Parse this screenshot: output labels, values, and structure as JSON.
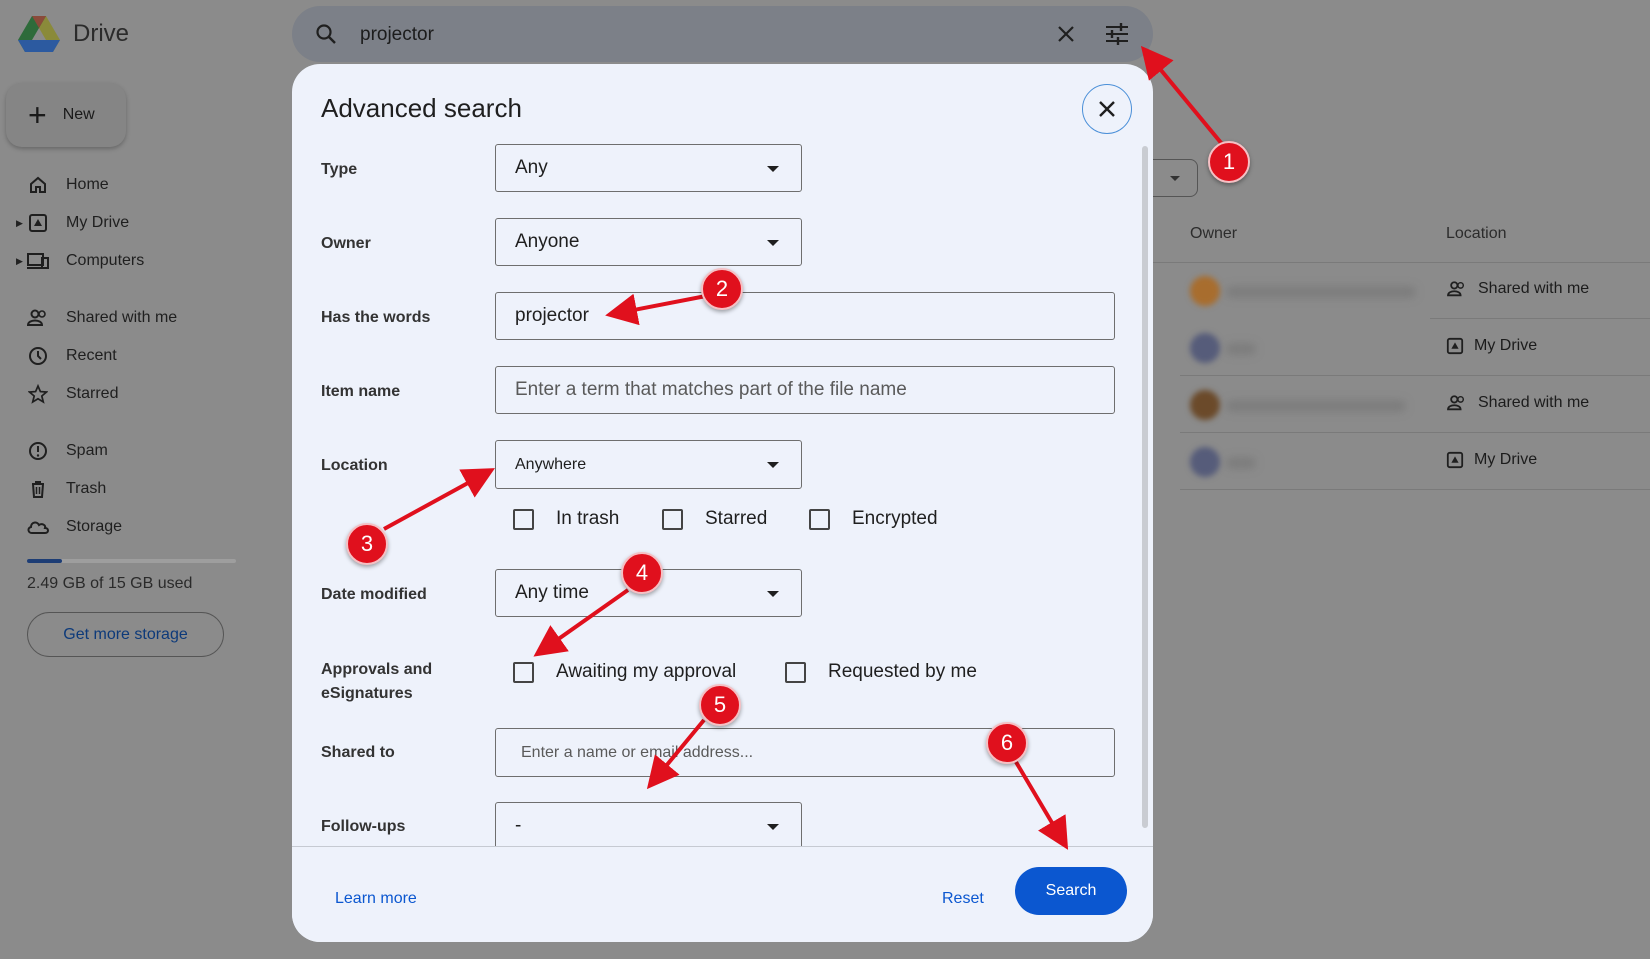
{
  "app": {
    "name": "Drive"
  },
  "sidebar": {
    "new_label": "New",
    "items": [
      {
        "label": "Home",
        "icon": "home-icon"
      },
      {
        "label": "My Drive",
        "icon": "my-drive-icon"
      },
      {
        "label": "Computers",
        "icon": "computers-icon"
      },
      {
        "label": "Shared with me",
        "icon": "people-icon"
      },
      {
        "label": "Recent",
        "icon": "clock-icon"
      },
      {
        "label": "Starred",
        "icon": "star-icon"
      },
      {
        "label": "Spam",
        "icon": "spam-icon"
      },
      {
        "label": "Trash",
        "icon": "trash-icon"
      },
      {
        "label": "Storage",
        "icon": "cloud-icon"
      }
    ],
    "storage_used_fraction": 0.166,
    "storage_text": "2.49 GB of 15 GB used",
    "get_more_storage": "Get more storage"
  },
  "search": {
    "query": "projector"
  },
  "file_list": {
    "columns": {
      "owner": "Owner",
      "location": "Location"
    },
    "rows": [
      {
        "location": "Shared with me",
        "location_icon": "people-icon"
      },
      {
        "location": "My Drive",
        "location_icon": "my-drive-icon"
      },
      {
        "location": "Shared with me",
        "location_icon": "people-icon"
      },
      {
        "location": "My Drive",
        "location_icon": "my-drive-icon"
      }
    ]
  },
  "dialog": {
    "title": "Advanced search",
    "type": {
      "label": "Type",
      "value": "Any"
    },
    "owner": {
      "label": "Owner",
      "value": "Anyone"
    },
    "has_words": {
      "label": "Has the words",
      "value": "projector"
    },
    "item_name": {
      "label": "Item name",
      "placeholder": "Enter a term that matches part of the file name"
    },
    "location": {
      "label": "Location",
      "value": "Anywhere",
      "checks": [
        "In trash",
        "Starred",
        "Encrypted"
      ]
    },
    "date_modified": {
      "label": "Date modified",
      "value": "Any time"
    },
    "approvals": {
      "label_line1": "Approvals and",
      "label_line2": "eSignatures",
      "checks": [
        "Awaiting my approval",
        "Requested by me"
      ]
    },
    "shared_to": {
      "label": "Shared to",
      "placeholder": "Enter a name or email address..."
    },
    "follow_ups": {
      "label": "Follow-ups",
      "value": "-"
    },
    "learn_more": "Learn more",
    "reset": "Reset",
    "search": "Search"
  },
  "annotations": {
    "badges": [
      "1",
      "2",
      "3",
      "4",
      "5",
      "6"
    ],
    "color": "#e0101d"
  }
}
